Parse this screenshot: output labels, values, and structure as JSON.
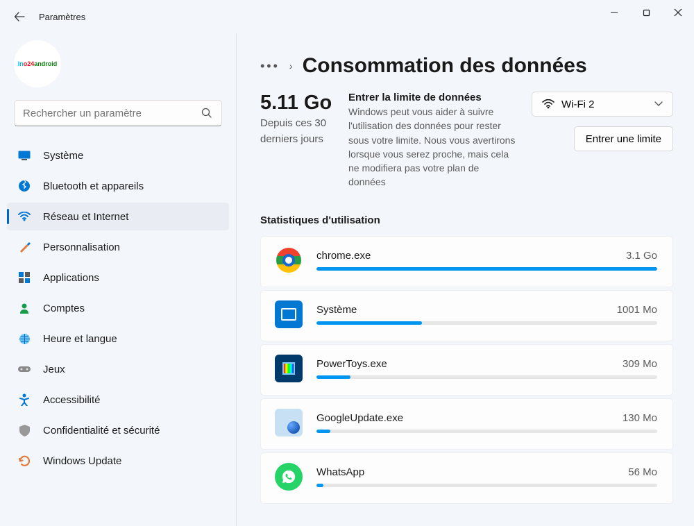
{
  "window": {
    "title": "Paramètres"
  },
  "search": {
    "placeholder": "Rechercher un paramètre"
  },
  "nav": {
    "items": [
      {
        "label": "Système"
      },
      {
        "label": "Bluetooth et appareils"
      },
      {
        "label": "Réseau et Internet"
      },
      {
        "label": "Personnalisation"
      },
      {
        "label": "Applications"
      },
      {
        "label": "Comptes"
      },
      {
        "label": "Heure et langue"
      },
      {
        "label": "Jeux"
      },
      {
        "label": "Accessibilité"
      },
      {
        "label": "Confidentialité et sécurité"
      },
      {
        "label": "Windows Update"
      }
    ],
    "active_index": 2
  },
  "page": {
    "title": "Consommation des données",
    "summary": {
      "usage": "5.11 Go",
      "period": "Depuis ces 30 derniers jours",
      "limit_heading": "Entrer la limite de données",
      "limit_description": "Windows peut vous aider à suivre l'utilisation des données pour rester sous votre limite. Nous vous avertirons lorsque vous serez proche, mais cela ne modifiera pas votre plan de données",
      "network_label": "Wi-Fi 2",
      "limit_button": "Entrer une limite"
    },
    "stats_heading": "Statistiques d'utilisation",
    "apps": [
      {
        "name": "chrome.exe",
        "usage": "3.1 Go",
        "percent": 100
      },
      {
        "name": "Système",
        "usage": "1001 Mo",
        "percent": 31
      },
      {
        "name": "PowerToys.exe",
        "usage": "309 Mo",
        "percent": 10
      },
      {
        "name": "GoogleUpdate.exe",
        "usage": "130 Mo",
        "percent": 4
      },
      {
        "name": "WhatsApp",
        "usage": "56 Mo",
        "percent": 2
      }
    ]
  }
}
